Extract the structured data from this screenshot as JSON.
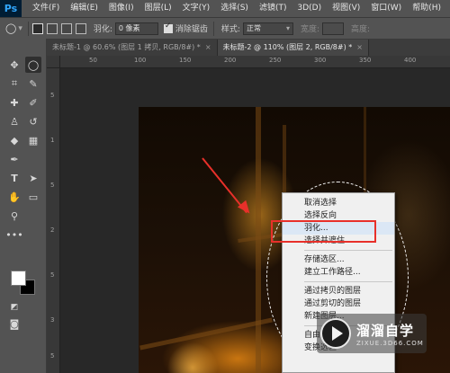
{
  "menubar": {
    "logo": "Ps",
    "items": [
      "文件(F)",
      "编辑(E)",
      "图像(I)",
      "图层(L)",
      "文字(Y)",
      "选择(S)",
      "滤镜(T)",
      "3D(D)",
      "视图(V)",
      "窗口(W)",
      "帮助(H)"
    ]
  },
  "options": {
    "feather_label": "羽化:",
    "feather_value": "0 像素",
    "antialias_label": "消除锯齿",
    "style_label": "样式:",
    "style_value": "正常",
    "width_label": "宽度:",
    "height_label": "高度:"
  },
  "tabs": [
    {
      "title": "未标题-1 @ 60.6% (图层 1 拷贝, RGB/8#) *",
      "close": "×"
    },
    {
      "title": "未标题-2 @ 110% (图层 2, RGB/8#) *",
      "close": "×"
    }
  ],
  "toolbar": {
    "icons": [
      "move-icon",
      "marquee-icon",
      "crop-icon",
      "eyedropper-icon",
      "healing-icon",
      "brush-icon",
      "clone-stamp-icon",
      "history-brush-icon",
      "eraser-icon",
      "gradient-icon",
      "pen-icon",
      "type-icon",
      "path-selection-icon",
      "rectangle-icon",
      "hand-icon",
      "zoom-icon",
      "more-icon"
    ],
    "foreground_color": "#ffffff",
    "background_color": "#000000"
  },
  "rulers": {
    "top": [
      "50",
      "100",
      "150",
      "200",
      "250",
      "300",
      "350",
      "400"
    ],
    "left": [
      "5",
      "1",
      "5",
      "2",
      "5",
      "3",
      "5"
    ]
  },
  "context_menu": {
    "items": [
      "取消选择",
      "选择反向",
      "羽化...",
      "选择并遮住...",
      "存储选区...",
      "建立工作路径...",
      "通过拷贝的图层",
      "通过剪切的图层",
      "新建图层...",
      "自由变换",
      "变换选区"
    ],
    "highlighted": "羽化...",
    "accent": "#e8302a"
  },
  "watermark": {
    "title": "溜溜自学",
    "subtitle": "ZIXUE.3D66.COM"
  }
}
